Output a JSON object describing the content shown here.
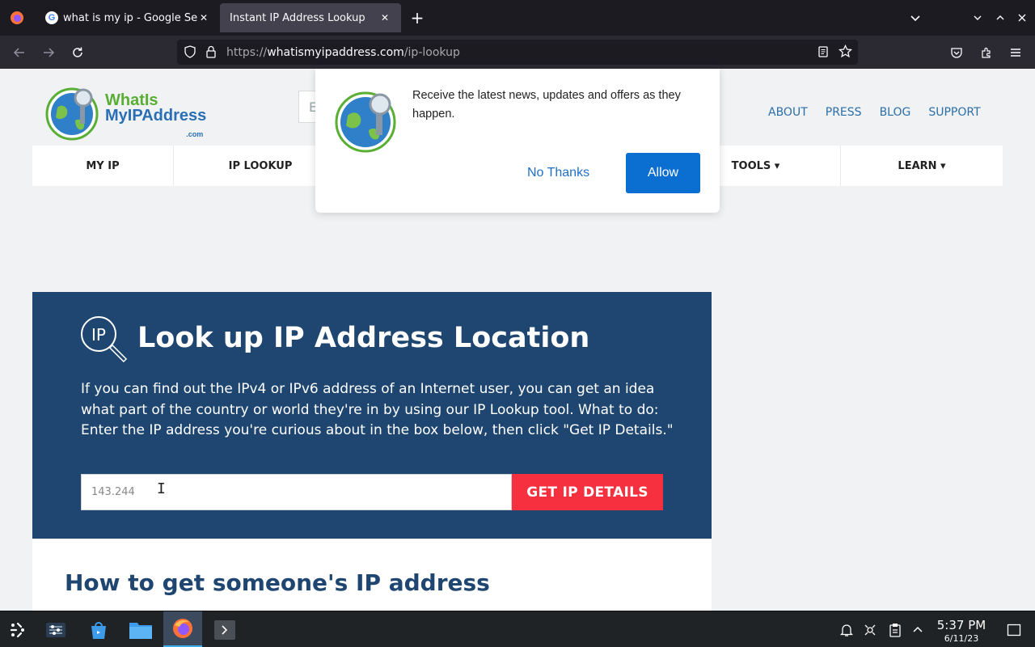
{
  "browser": {
    "tabs": [
      {
        "title": "what is my ip - Google Sea",
        "active": false
      },
      {
        "title": "Instant IP Address Lookup",
        "active": true
      }
    ],
    "url_prefix": "https://",
    "url_domain": "whatismyipaddress.com",
    "url_path": "/ip-lookup"
  },
  "site": {
    "logo": {
      "line1": "WhatIs",
      "line2": "MyIPAddress",
      "suffix": ".com"
    },
    "search_stub": "E",
    "top_links": [
      "ABOUT",
      "PRESS",
      "BLOG",
      "SUPPORT"
    ],
    "nav": {
      "my_ip": "MY IP",
      "ip_lookup": "IP LOOKUP",
      "tools": "TOOLS ▾",
      "learn": "LEARN ▾"
    },
    "hero": {
      "icon_text": "IP",
      "title": "Look up IP Address Location",
      "description": "If you can find out the IPv4 or IPv6 address of an Internet user, you can get an idea what part of the country or world they're in by using our IP Lookup tool. What to do: Enter the IP address you're curious about in the box below, then click \"Get IP Details.\"",
      "input_value": "143.244",
      "button": "GET IP DETAILS"
    },
    "section_heading": "How to get someone's IP address"
  },
  "popup": {
    "message": "Receive the latest news, updates and offers as they happen.",
    "no_thanks": "No Thanks",
    "allow": "Allow"
  },
  "taskbar": {
    "time": "5:37 PM",
    "date": "6/11/23"
  },
  "colors": {
    "hero_bg": "#1f4670",
    "button_red": "#f7303f",
    "link_blue": "#2b6ea8",
    "allow_blue": "#0b6fd1"
  }
}
